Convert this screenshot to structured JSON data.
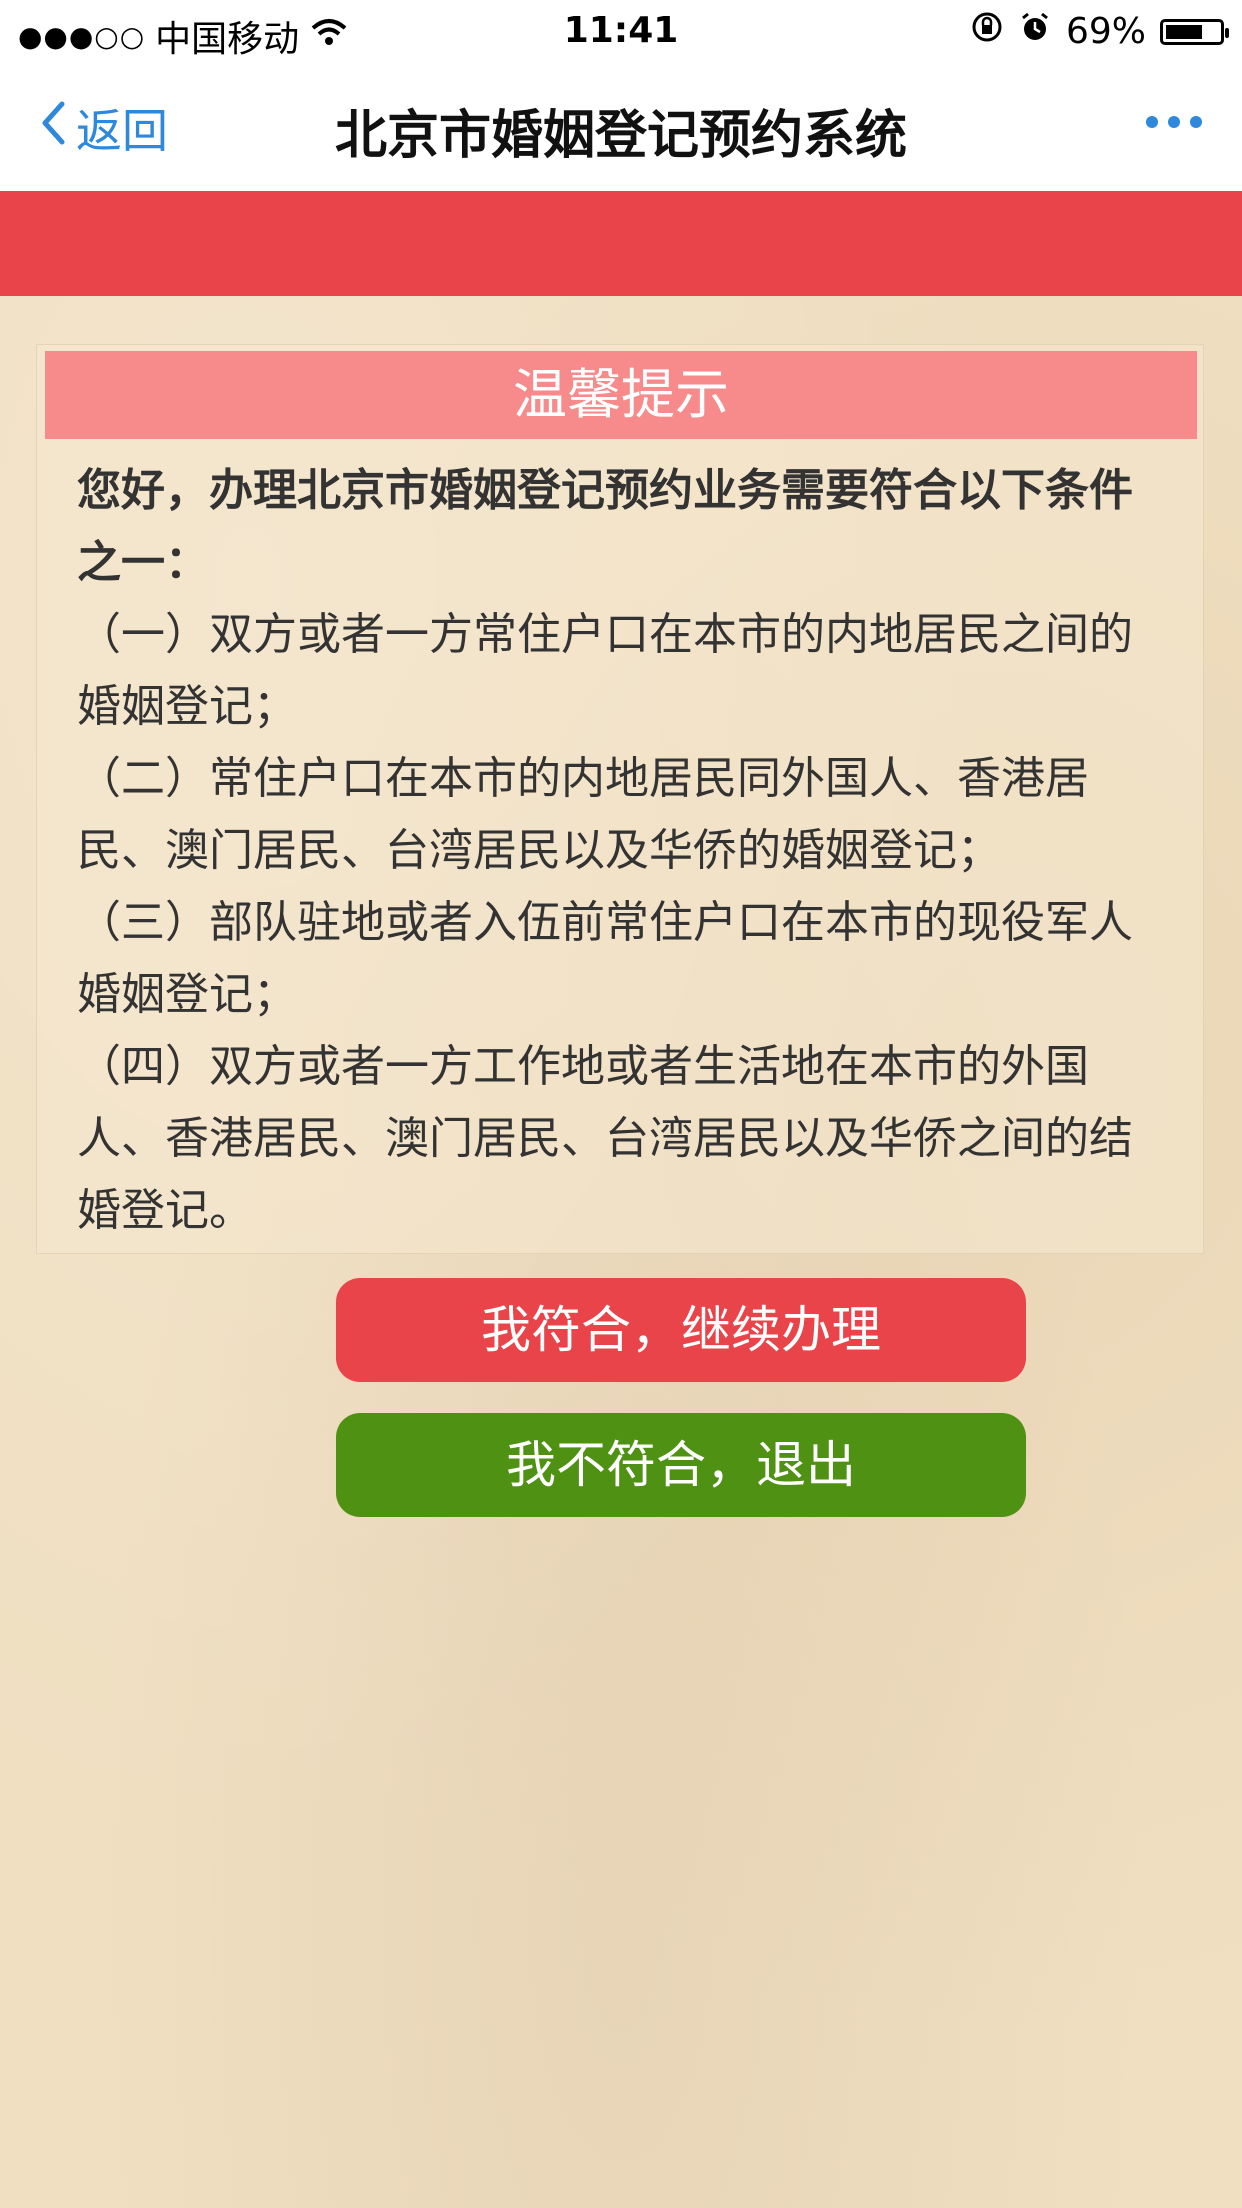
{
  "status_bar": {
    "signal": "●●●○○",
    "carrier": "中国移动",
    "time": "11:41",
    "battery_pct_label": "69%",
    "battery_level": 0.69
  },
  "nav": {
    "back_label": "返回",
    "title": "北京市婚姻登记预约系统"
  },
  "notice": {
    "header": "温馨提示",
    "intro": "您好，办理北京市婚姻登记预约业务需要符合以下条件之一：",
    "items": [
      "（一）双方或者一方常住户口在本市的内地居民之间的婚姻登记；",
      "（二）常住户口在本市的内地居民同外国人、香港居民、澳门居民、台湾居民以及华侨的婚姻登记；",
      "（三）部队驻地或者入伍前常住户口在本市的现役军人婚姻登记；",
      "（四）双方或者一方工作地或者生活地在本市的外国人、香港居民、澳门居民、台湾居民以及华侨之间的结婚登记。"
    ]
  },
  "buttons": {
    "continue_label": "我符合，继续办理",
    "exit_label": "我不符合，退出"
  },
  "colors": {
    "accent_red": "#e8444a",
    "header_pink": "#f78a8a",
    "exit_green": "#4f9113",
    "link_blue": "#2e88db"
  }
}
